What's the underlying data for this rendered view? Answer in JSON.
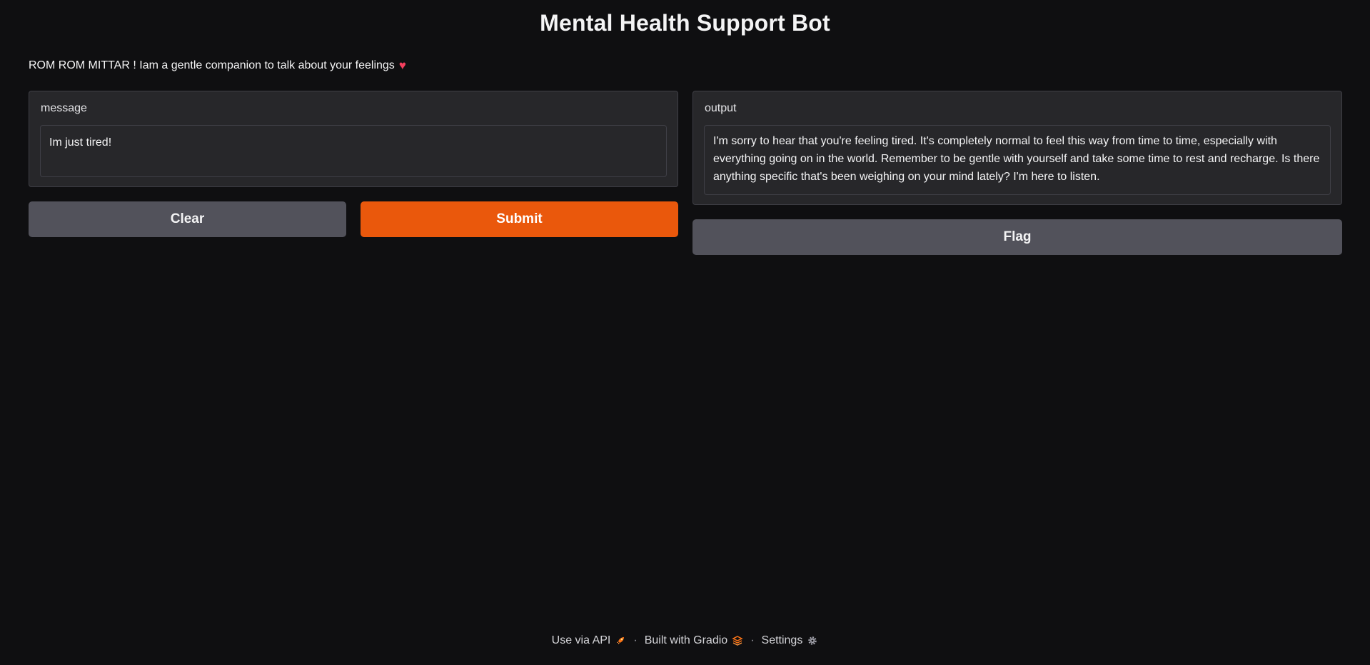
{
  "app": {
    "title": "Mental Health Support Bot",
    "description": "ROM ROM MITTAR ! Iam a gentle companion to talk about your feelings",
    "description_emoji": "heart-icon"
  },
  "input_panel": {
    "label": "message",
    "value": "Im just tired!"
  },
  "output_panel": {
    "label": "output",
    "value": "I'm sorry to hear that you're feeling tired. It's completely normal to feel this way from time to time, especially with everything going on in the world. Remember to be gentle with yourself and take some time to rest and recharge. Is there anything specific that's been weighing on your mind lately? I'm here to listen."
  },
  "buttons": {
    "clear": "Clear",
    "submit": "Submit",
    "flag": "Flag"
  },
  "footer": {
    "api": "Use via API",
    "api_icon": "rocket-icon",
    "built": "Built with Gradio",
    "built_icon": "gradio-logo-icon",
    "settings": "Settings",
    "settings_icon": "gear-icon",
    "separator": "·"
  },
  "colors": {
    "background": "#0f0f11",
    "panel": "#27272a",
    "primary": "#ea580c",
    "secondary": "#52525b"
  }
}
